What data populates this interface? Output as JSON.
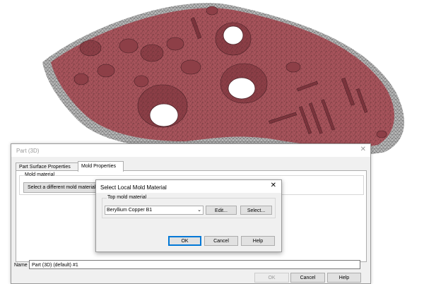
{
  "main_dialog": {
    "title": "Part (3D)",
    "close_glyph": "✕",
    "tabs": [
      {
        "label": "Part Surface Properties",
        "active": false
      },
      {
        "label": "Mold Properties",
        "active": true
      }
    ],
    "mold_material_group_label": "Mold material",
    "select_different_button": "Select a different mold material",
    "name_label": "Name",
    "name_value": "Part (3D) (default) #1",
    "buttons": {
      "ok": "OK",
      "cancel": "Cancel",
      "help": "Help"
    }
  },
  "sub_dialog": {
    "title": "Select Local Mold Material",
    "close_glyph": "✕",
    "group_label": "Top mold material",
    "selected_material": "Beryllium Copper B1",
    "edit_button": "Edit...",
    "select_button": "Select...",
    "buttons": {
      "ok": "OK",
      "cancel": "Cancel",
      "help": "Help"
    }
  },
  "viewport": {
    "mesh_color": "#a8545c",
    "mesh_edge_color": "#5a2a30",
    "background_color": "#ffffff"
  },
  "colors": {
    "dialog_bg": "#f0f0f0",
    "accent": "#0078d7"
  },
  "icons": {
    "dropdown": "chevron-down-icon",
    "close": "close-icon"
  }
}
